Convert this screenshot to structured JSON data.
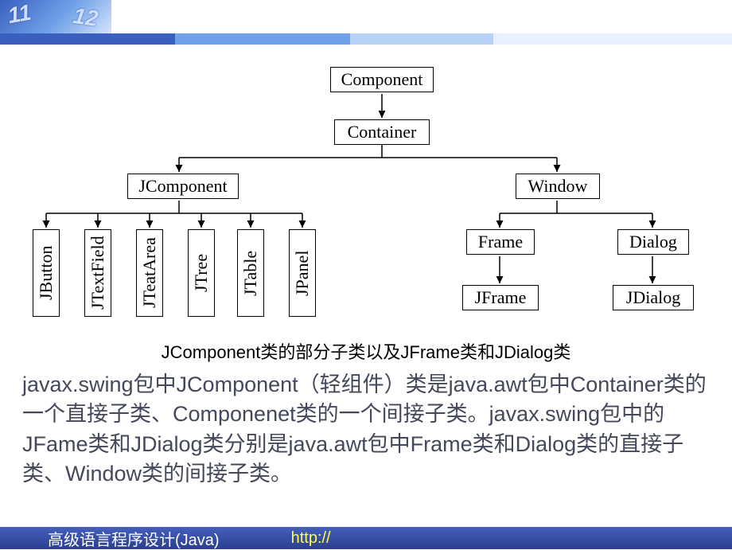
{
  "chart_data": {
    "type": "tree",
    "nodes": {
      "component": "Component",
      "container": "Container",
      "jcomponent": "JComponent",
      "window": "Window",
      "jbutton": "JButton",
      "jtextfield": "JTextField",
      "jtextarea": "JTeatArea",
      "jtree": "JTree",
      "jtable": "JTable",
      "jpanel": "JPanel",
      "frame": "Frame",
      "dialog": "Dialog",
      "jframe": "JFrame",
      "jdialog": "JDialog"
    },
    "edges": [
      [
        "component",
        "container"
      ],
      [
        "container",
        "jcomponent"
      ],
      [
        "container",
        "window"
      ],
      [
        "jcomponent",
        "jbutton"
      ],
      [
        "jcomponent",
        "jtextfield"
      ],
      [
        "jcomponent",
        "jtextarea"
      ],
      [
        "jcomponent",
        "jtree"
      ],
      [
        "jcomponent",
        "jtable"
      ],
      [
        "jcomponent",
        "jpanel"
      ],
      [
        "window",
        "frame"
      ],
      [
        "window",
        "dialog"
      ],
      [
        "frame",
        "jframe"
      ],
      [
        "dialog",
        "jdialog"
      ]
    ]
  },
  "caption": "JComponent类的部分子类以及JFrame类和JDialog类",
  "paragraph": "javax.swing包中JComponent（轻组件）类是java.awt包中Container类的一个直接子类、Componenet类的一个间接子类。javax.swing包中的JFame类和JDialog类分别是java.awt包中Frame类和Dialog类的直接子类、Window类的间接子类。",
  "footer": {
    "course": "高级语言程序设计(Java)",
    "linklabel": "http://"
  },
  "topnums": {
    "a": "11",
    "b": "12"
  }
}
